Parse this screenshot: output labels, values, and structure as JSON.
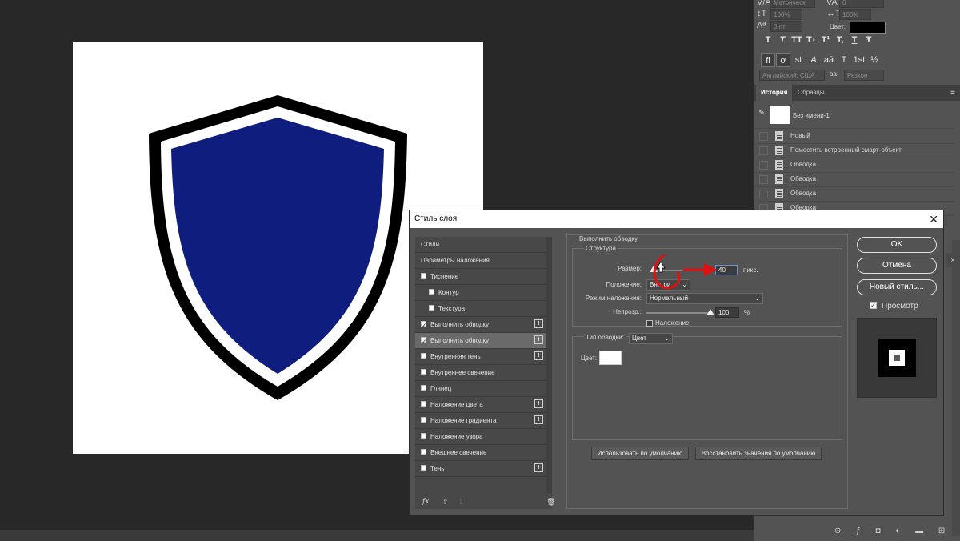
{
  "character_panel": {
    "font_size_value": "Метрическ",
    "tracking_value": "0",
    "vscale_value": "100%",
    "hscale_value": "100%",
    "baseline_value": "0 пт",
    "color_label": "Цвет:",
    "color_value": "#000000",
    "type_style_buttons": [
      "T",
      "T",
      "TT",
      "Tт",
      "T¹",
      "T,",
      "T",
      "Ŧ"
    ],
    "opentype_buttons": [
      "fi",
      "ơ",
      "st",
      "A",
      "aā",
      "T",
      "1st",
      "½"
    ],
    "language_value": "Английский: США",
    "aa_label": "aa",
    "antialias_value": "Резкое"
  },
  "history_panel": {
    "tabs": [
      "История",
      "Образцы"
    ],
    "snapshot_label": "Без имени-1",
    "items": [
      "Новый",
      "Поместить встроенный смарт-объект",
      "Обводка",
      "Обводка",
      "Обводка",
      "Обводка"
    ]
  },
  "dialog": {
    "title": "Стиль слоя",
    "styles": [
      {
        "label": "Стили",
        "checkbox": false,
        "checked": false,
        "indent": 0,
        "plus": false,
        "selected": false
      },
      {
        "label": "Параметры наложения",
        "checkbox": false,
        "checked": false,
        "indent": 0,
        "plus": false,
        "selected": false
      },
      {
        "label": "Тиснение",
        "checkbox": true,
        "checked": false,
        "indent": 0,
        "plus": false,
        "selected": false
      },
      {
        "label": "Контур",
        "checkbox": true,
        "checked": false,
        "indent": 1,
        "plus": false,
        "selected": false
      },
      {
        "label": "Текстура",
        "checkbox": true,
        "checked": false,
        "indent": 1,
        "plus": false,
        "selected": false
      },
      {
        "label": "Выполнить обводку",
        "checkbox": true,
        "checked": true,
        "indent": 0,
        "plus": true,
        "selected": false
      },
      {
        "label": "Выполнить обводку",
        "checkbox": true,
        "checked": true,
        "indent": 0,
        "plus": true,
        "selected": true
      },
      {
        "label": "Внутренняя тень",
        "checkbox": true,
        "checked": false,
        "indent": 0,
        "plus": true,
        "selected": false
      },
      {
        "label": "Внутреннее свечение",
        "checkbox": true,
        "checked": false,
        "indent": 0,
        "plus": false,
        "selected": false
      },
      {
        "label": "Глянец",
        "checkbox": true,
        "checked": false,
        "indent": 0,
        "plus": false,
        "selected": false
      },
      {
        "label": "Наложение цвета",
        "checkbox": true,
        "checked": false,
        "indent": 0,
        "plus": true,
        "selected": false
      },
      {
        "label": "Наложение градиента",
        "checkbox": true,
        "checked": false,
        "indent": 0,
        "plus": true,
        "selected": false
      },
      {
        "label": "Наложение узора",
        "checkbox": true,
        "checked": false,
        "indent": 0,
        "plus": false,
        "selected": false
      },
      {
        "label": "Внешнее свечение",
        "checkbox": true,
        "checked": false,
        "indent": 0,
        "plus": false,
        "selected": false
      },
      {
        "label": "Тень",
        "checkbox": true,
        "checked": false,
        "indent": 0,
        "plus": true,
        "selected": false
      }
    ],
    "fx_label": "fx",
    "stroke": {
      "section_title": "Выполнить обводку",
      "structure_title": "Структура",
      "size_label": "Размер:",
      "size_value": "40",
      "size_unit": "пикс.",
      "size_fraction": 0.04,
      "position_label": "Положение:",
      "position_value": "Внутри",
      "blend_label": "Режим наложения:",
      "blend_value": "Нормальный",
      "opacity_label": "Непрозр.:",
      "opacity_value": "100",
      "opacity_unit": "%",
      "opacity_fraction": 1.0,
      "overprint_label": "Наложение",
      "fill_type_label": "Тип обводки:",
      "fill_type_value": "Цвет",
      "color_label": "Цвет:",
      "color_value": "#ffffff",
      "use_default": "Использовать по умолчанию",
      "reset_default": "Восстановить значения по умолчанию"
    },
    "buttons": {
      "ok": "OK",
      "cancel": "Отмена",
      "new_style": "Новый стиль...",
      "preview_label": "Просмотр"
    }
  },
  "colors": {
    "shield_fill": "#0f1e7e",
    "annotation": "#e01010"
  }
}
